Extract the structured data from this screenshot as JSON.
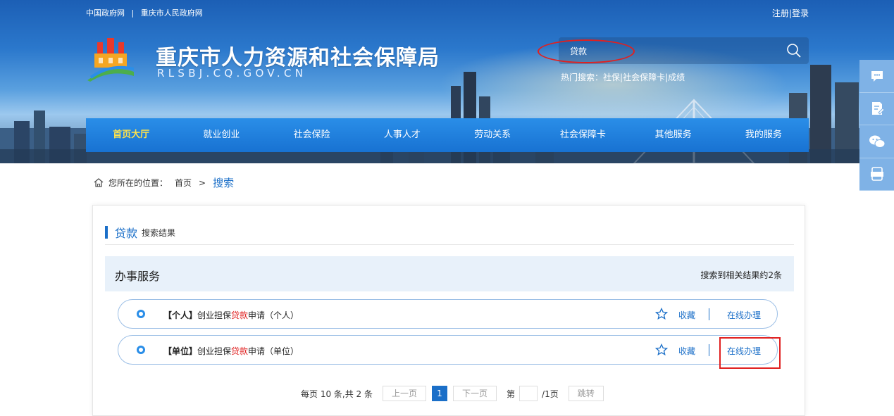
{
  "top": {
    "links": [
      "中国政府网",
      "重庆市人民政府网"
    ],
    "separator": "|",
    "user": {
      "register": "注册",
      "sep": "|",
      "login": "登录"
    }
  },
  "brand": {
    "title": "重庆市人力资源和社会保障局",
    "domain": "RLSBJ.CQ.GOV.CN"
  },
  "search": {
    "value": "贷款",
    "hot_label": "热门搜索：",
    "hot_terms": [
      "社保",
      "社会保障卡",
      "成绩"
    ],
    "hot_sep": "|"
  },
  "nav": {
    "items": [
      "首页大厅",
      "就业创业",
      "社会保险",
      "人事人才",
      "劳动关系",
      "社会保障卡",
      "其他服务",
      "我的服务"
    ],
    "active_index": 0
  },
  "breadcrumb": {
    "label": "您所在的位置：",
    "home": "首页",
    "arrow": ">",
    "current": "搜索"
  },
  "results": {
    "keyword": "贷款",
    "suffix": "搜索结果",
    "section_title": "办事服务",
    "count_text": "搜索到相关结果约2条",
    "items": [
      {
        "tag": "【个人】",
        "pre": "创业担保",
        "kw": "贷款",
        "post": "申请（个人）",
        "fav": "收藏",
        "action": "在线办理"
      },
      {
        "tag": "【单位】",
        "pre": "创业担保",
        "kw": "贷款",
        "post": "申请（单位）",
        "fav": "收藏",
        "action": "在线办理"
      }
    ]
  },
  "pager": {
    "summary": "每页 10 条,共 2 条",
    "prev": "上一页",
    "current": "1",
    "next": "下一页",
    "page_label": "第",
    "total": "/1页",
    "jump": "跳转"
  },
  "colors": {
    "accent": "#1b6fc8",
    "nav_active": "#ffe24a",
    "keyword_red": "#e02020",
    "highlight_red": "#e02020"
  }
}
